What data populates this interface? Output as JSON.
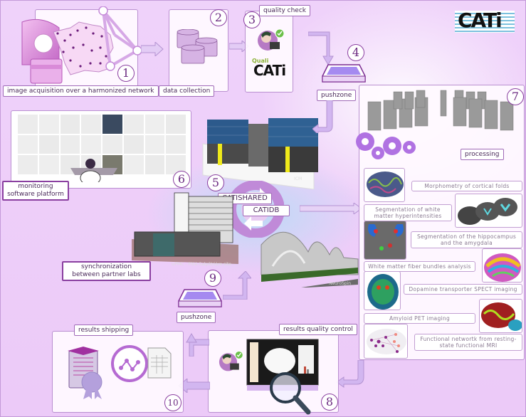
{
  "logo": {
    "text": "CATi",
    "colors": {
      "stripes": "#5bb3d6",
      "letters": "#111111"
    }
  },
  "steps": [
    {
      "number": "1",
      "label": "image acquisition over a harmonized network"
    },
    {
      "number": "2",
      "label": "data collection"
    },
    {
      "number": "3",
      "label": "quality check",
      "tool_name_prefix": "Quali",
      "tool_name": "CATi"
    },
    {
      "number": "4",
      "label": "pushzone"
    },
    {
      "number": "5",
      "databases": [
        "CATISHARED",
        "CATIDB"
      ],
      "site_label": "ICM"
    },
    {
      "number": "6",
      "label": "monitoring software platform"
    },
    {
      "number": "7",
      "label": "processing"
    },
    {
      "number": "8",
      "label": "results quality control"
    },
    {
      "number": "9",
      "label": "synchronization between partner labs",
      "pushzone_label": "pushzone",
      "sites": [
        "UPMC - Pitié-Salpêtrière site",
        "NeuroSpin"
      ]
    },
    {
      "number": "10",
      "label": "results shipping"
    }
  ],
  "processing_items": [
    "Morphometry of cortical folds",
    "Segmentation of white matter hyperintensities",
    "Segmentation of the hippocampus and the amygdala",
    "White matter fiber bundles analysis",
    "Dopamine transporter SPECT imaging",
    "Amyloid PET imaging",
    "Functional networtk from resting-state functional MRI"
  ],
  "colors": {
    "background": "#ecc8f8",
    "accent": "#8a3fa0",
    "arrow": "#c9a8ef",
    "panel": "#fdf8ff"
  }
}
